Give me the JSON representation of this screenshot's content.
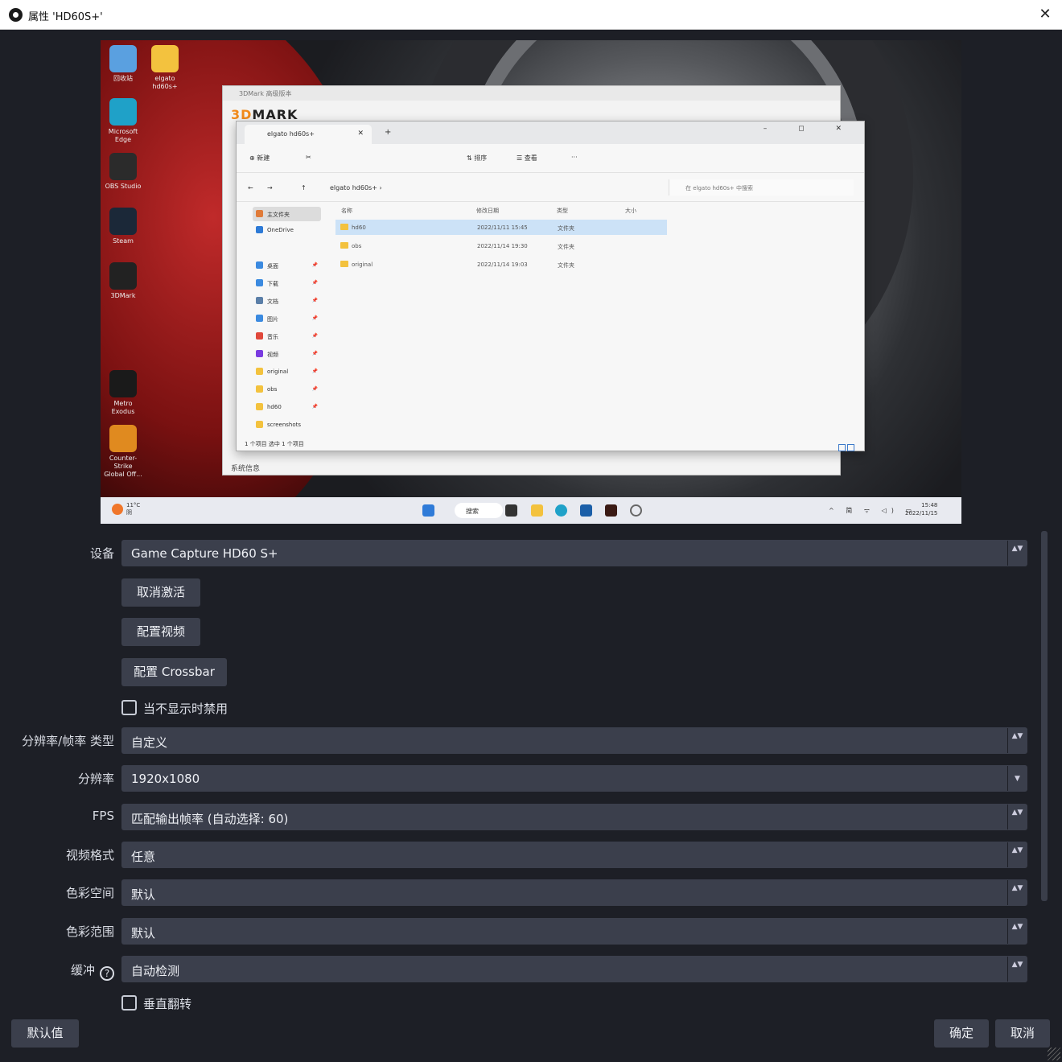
{
  "window": {
    "title": "属性 'HD60S+'",
    "close_label": "✕"
  },
  "preview": {
    "desktop_icons": [
      {
        "label": "回收站",
        "color": "#5aa0e0"
      },
      {
        "label": "elgato hd60s+",
        "color": "#f3c23e"
      },
      {
        "label": "Microsoft Edge",
        "color": "#1fa1c8"
      },
      {
        "label": "OBS Studio",
        "color": "#2b2b2b"
      },
      {
        "label": "Steam",
        "color": "#1b2838"
      },
      {
        "label": "3DMark",
        "color": "#222222"
      },
      {
        "label": "Metro Exodus",
        "color": "#1a1a1a"
      },
      {
        "label": "Counter-Strike Global Off...",
        "color": "#e08a1f"
      }
    ],
    "dmark": {
      "titlebar": "3DMark 高级版本",
      "logo_prefix": "3D",
      "logo_suffix": "MARK",
      "status": "系统信息"
    },
    "explorer": {
      "tab_label": "elgato hd60s+",
      "tab_close": "✕",
      "new_tab": "+",
      "window_controls": "– ◻ ✕",
      "toolbar": {
        "new": "⊕ 新建",
        "cut": "✂",
        "sort": "⇅ 排序",
        "view": "☰ 查看",
        "more": "···"
      },
      "address": {
        "back": "←",
        "forward": "→",
        "up": "↑",
        "path": "elgato hd60s+  ›",
        "search_placeholder": "在 elgato hd60s+ 中搜索"
      },
      "nav": [
        {
          "label": "主文件夹",
          "color": "#e07b39",
          "selected": true
        },
        {
          "label": "OneDrive",
          "color": "#2d7ad6"
        },
        {
          "label": "桌面",
          "color": "#3b8ae0"
        },
        {
          "label": "下载",
          "color": "#3b8ae0"
        },
        {
          "label": "文档",
          "color": "#5b7fa8"
        },
        {
          "label": "图片",
          "color": "#3b8ae0"
        },
        {
          "label": "音乐",
          "color": "#e0483b"
        },
        {
          "label": "视频",
          "color": "#7a3be0"
        },
        {
          "label": "original",
          "color": "#f3c23e"
        },
        {
          "label": "obs",
          "color": "#f3c23e"
        },
        {
          "label": "hd60",
          "color": "#f3c23e"
        },
        {
          "label": "screenshots",
          "color": "#f3c23e"
        }
      ],
      "columns": [
        "名称",
        "修改日期",
        "类型",
        "大小"
      ],
      "rows": [
        {
          "name": "hd60",
          "date": "2022/11/11 15:45",
          "type": "文件夹",
          "selected": true
        },
        {
          "name": "obs",
          "date": "2022/11/14 19:30",
          "type": "文件夹"
        },
        {
          "name": "original",
          "date": "2022/11/14 19:03",
          "type": "文件夹"
        }
      ],
      "status": "1 个项目    选中 1 个项目"
    },
    "taskbar": {
      "weather_temp": "11°C",
      "weather_text": "阴",
      "search_label": "搜索",
      "tray": "^ 简 ᯤ ◁) ▭",
      "time": "15:48",
      "date": "2022/11/15"
    }
  },
  "form": {
    "device": {
      "label": "设备",
      "value": "Game Capture HD60 S+"
    },
    "deactivate_button": "取消激活",
    "configure_video_button": "配置视频",
    "configure_crossbar_button": "配置 Crossbar",
    "deactivate_when_not_showing": {
      "label": "当不显示时禁用",
      "checked": false
    },
    "res_fps_type": {
      "label": "分辨率/帧率 类型",
      "value": "自定义"
    },
    "resolution": {
      "label": "分辨率",
      "value": "1920x1080"
    },
    "fps": {
      "label": "FPS",
      "value": "匹配输出帧率 (自动选择: 60)"
    },
    "video_format": {
      "label": "视频格式",
      "value": "任意"
    },
    "color_space": {
      "label": "色彩空间",
      "value": "默认"
    },
    "color_range": {
      "label": "色彩范围",
      "value": "默认"
    },
    "buffering": {
      "label": "缓冲",
      "value": "自动检测",
      "help": "?"
    },
    "flip_vertically": {
      "label": "垂直翻转",
      "checked": false
    }
  },
  "footer": {
    "defaults_button": "默认值",
    "ok_button": "确定",
    "cancel_button": "取消"
  },
  "icons": {
    "updown": "▲▼",
    "down": "▼"
  }
}
